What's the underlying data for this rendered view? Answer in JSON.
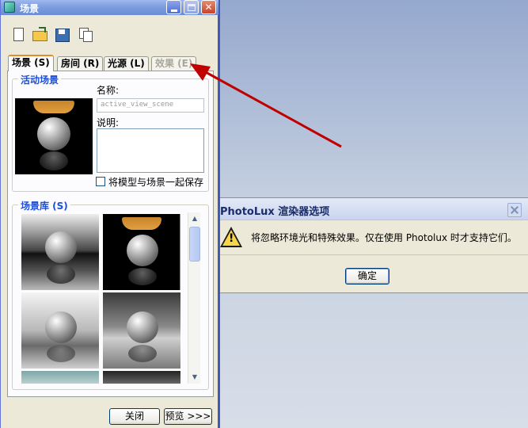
{
  "window": {
    "title": "场景"
  },
  "tabs": [
    {
      "label": "场景 (S)",
      "active": true,
      "enabled": true
    },
    {
      "label": "房间 (R)",
      "active": false,
      "enabled": true
    },
    {
      "label": "光源 (L)",
      "active": false,
      "enabled": true
    },
    {
      "label": "效果 (E)",
      "active": false,
      "enabled": false
    }
  ],
  "active_scene": {
    "group_title": "活动场景",
    "name_label": "名称:",
    "name_value": "active_view_scene",
    "desc_label": "说明:",
    "desc_value": "",
    "save_checkbox_label": "将模型与场景一起保存",
    "save_checked": false
  },
  "scene_library": {
    "group_title": "场景库 (S)"
  },
  "buttons": {
    "close": "关闭",
    "preview": "预览 >>>"
  },
  "dialog": {
    "title": "PhotoLux 渲染器选项",
    "warn_glyph": "!",
    "message": "将忽略环境光和特殊效果。仅在使用 Photolux 时才支持它们。",
    "ok": "确定"
  },
  "icons": {
    "toolbar": [
      "new-document-icon",
      "open-folder-icon",
      "save-icon",
      "copy-icon"
    ],
    "scrollbar": [
      "scroll-up-icon",
      "scroll-down-icon"
    ]
  },
  "colors": {
    "accent_title": "#1c4fd8",
    "arrow": "#c00000",
    "tab_highlight": "#e68b2c"
  }
}
